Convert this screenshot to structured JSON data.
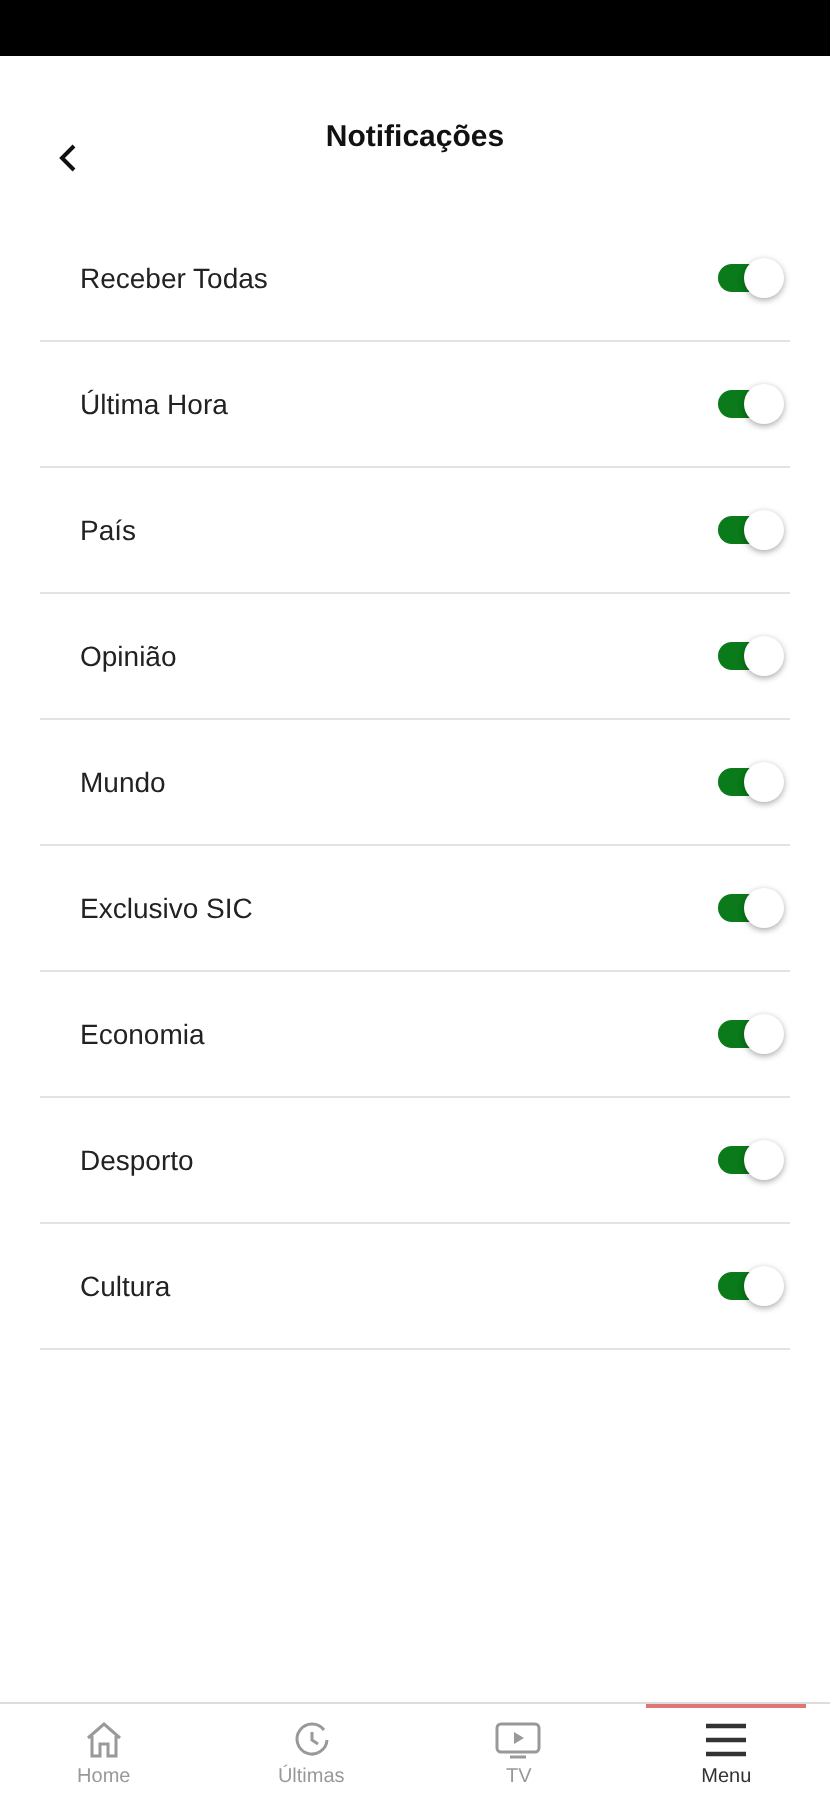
{
  "header": {
    "title": "Notificações"
  },
  "settings": [
    {
      "label": "Receber Todas",
      "on": true
    },
    {
      "label": "Última Hora",
      "on": true
    },
    {
      "label": "País",
      "on": true
    },
    {
      "label": "Opinião",
      "on": true
    },
    {
      "label": "Mundo",
      "on": true
    },
    {
      "label": "Exclusivo SIC",
      "on": true
    },
    {
      "label": "Economia",
      "on": true
    },
    {
      "label": "Desporto",
      "on": true
    },
    {
      "label": "Cultura",
      "on": true
    }
  ],
  "nav": [
    {
      "label": "Home",
      "kind": "home",
      "selected": false
    },
    {
      "label": "Últimas",
      "kind": "recent",
      "selected": false
    },
    {
      "label": "TV",
      "kind": "tv",
      "selected": false
    },
    {
      "label": "Menu",
      "kind": "menu",
      "selected": true
    }
  ]
}
